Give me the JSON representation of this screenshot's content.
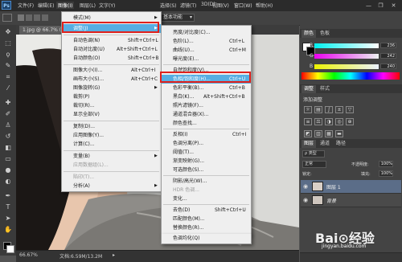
{
  "menubar": {
    "logo": "Ps",
    "items": [
      "文件(F)",
      "编辑(E)",
      "图像(I)",
      "图层(L)",
      "文字(Y)",
      "选择(S)",
      "滤镜(T)",
      "3D(D)",
      "视图(V)",
      "窗口(W)",
      "帮助(H)"
    ],
    "window_buttons": [
      "—",
      "❐",
      "✕"
    ]
  },
  "options_bar": {
    "field": "基本功能",
    "chevron": "▾"
  },
  "doc_tab": {
    "label": "1.jpg @ 66.7% (",
    "close": "×"
  },
  "status": {
    "zoom": "66.67%",
    "doc": "文档:6.59M/13.2M",
    "arrow": "▸"
  },
  "image_menu": {
    "items": [
      {
        "label": "模式(M)",
        "shortcut": "",
        "submenu": true
      },
      {
        "label": "调整(J)",
        "shortcut": "",
        "submenu": true,
        "highlight": true
      },
      {
        "label": "自动色调(N)",
        "shortcut": "Shift+Ctrl+L"
      },
      {
        "label": "自动对比度(U)",
        "shortcut": "Alt+Shift+Ctrl+L"
      },
      {
        "label": "自动颜色(O)",
        "shortcut": "Shift+Ctrl+B"
      },
      {
        "label": "图像大小(I)...",
        "shortcut": "Alt+Ctrl+I"
      },
      {
        "label": "画布大小(S)...",
        "shortcut": "Alt+Ctrl+C"
      },
      {
        "label": "图像旋转(G)",
        "shortcut": "",
        "submenu": true
      },
      {
        "label": "裁剪(P)",
        "shortcut": ""
      },
      {
        "label": "裁切(R)...",
        "shortcut": ""
      },
      {
        "label": "显示全部(V)",
        "shortcut": ""
      },
      {
        "label": "复制(D)...",
        "shortcut": ""
      },
      {
        "label": "应用图像(Y)...",
        "shortcut": ""
      },
      {
        "label": "计算(C)...",
        "shortcut": ""
      },
      {
        "label": "变量(B)",
        "shortcut": "",
        "submenu": true
      },
      {
        "label": "应用数据组(L)...",
        "shortcut": "",
        "disabled": true
      },
      {
        "label": "陷印(T)...",
        "shortcut": "",
        "disabled": true
      },
      {
        "label": "分析(A)",
        "shortcut": "",
        "submenu": true
      }
    ]
  },
  "adjust_menu": {
    "items": [
      {
        "label": "亮度/对比度(C)...",
        "shortcut": ""
      },
      {
        "label": "色阶(L)...",
        "shortcut": "Ctrl+L"
      },
      {
        "label": "曲线(U)...",
        "shortcut": "Ctrl+M"
      },
      {
        "label": "曝光度(E)...",
        "shortcut": ""
      },
      {
        "label": "自然饱和度(V)...",
        "shortcut": ""
      },
      {
        "label": "色相/饱和度(H)...",
        "shortcut": "Ctrl+U",
        "highlight": true
      },
      {
        "label": "色彩平衡(B)...",
        "shortcut": "Ctrl+B"
      },
      {
        "label": "黑白(K)...",
        "shortcut": "Alt+Shift+Ctrl+B"
      },
      {
        "label": "照片滤镜(F)...",
        "shortcut": ""
      },
      {
        "label": "通道混合器(X)...",
        "shortcut": ""
      },
      {
        "label": "颜色查找...",
        "shortcut": ""
      },
      {
        "label": "反相(I)",
        "shortcut": "Ctrl+I"
      },
      {
        "label": "色调分离(P)...",
        "shortcut": ""
      },
      {
        "label": "阈值(T)...",
        "shortcut": ""
      },
      {
        "label": "渐变映射(G)...",
        "shortcut": ""
      },
      {
        "label": "可选颜色(S)...",
        "shortcut": ""
      },
      {
        "label": "阴影/高光(W)...",
        "shortcut": ""
      },
      {
        "label": "HDR 色调...",
        "shortcut": "",
        "disabled": true
      },
      {
        "label": "变化...",
        "shortcut": ""
      },
      {
        "label": "去色(D)",
        "shortcut": "Shift+Ctrl+U"
      },
      {
        "label": "匹配颜色(M)...",
        "shortcut": ""
      },
      {
        "label": "替换颜色(R)...",
        "shortcut": ""
      },
      {
        "label": "色调均化(Q)",
        "shortcut": ""
      }
    ]
  },
  "color_panel": {
    "tabs": [
      "颜色",
      "色板"
    ],
    "sliders": [
      {
        "label": "R",
        "value": "236"
      },
      {
        "label": "G",
        "value": "242"
      },
      {
        "label": "B",
        "value": "240"
      }
    ]
  },
  "adjust_panel": {
    "tabs": [
      "调整",
      "样式"
    ],
    "title": "添加调整"
  },
  "layers_panel": {
    "tabs": [
      "图层",
      "通道",
      "路径"
    ],
    "kind": "ρ 类型",
    "blend": "正常",
    "opacity_label": "不透明度:",
    "opacity": "100%",
    "lock_label": "锁定:",
    "fill_label": "填充:",
    "fill": "100%",
    "layers": [
      {
        "name": "图层 1",
        "selected": true
      },
      {
        "name": "背景",
        "selected": false
      }
    ]
  },
  "watermark": {
    "text": "Bai⊙经验",
    "url": "jingyan.baidu.com"
  },
  "colors": {
    "highlight": "#56aee2",
    "redbox": "#e0211c"
  }
}
